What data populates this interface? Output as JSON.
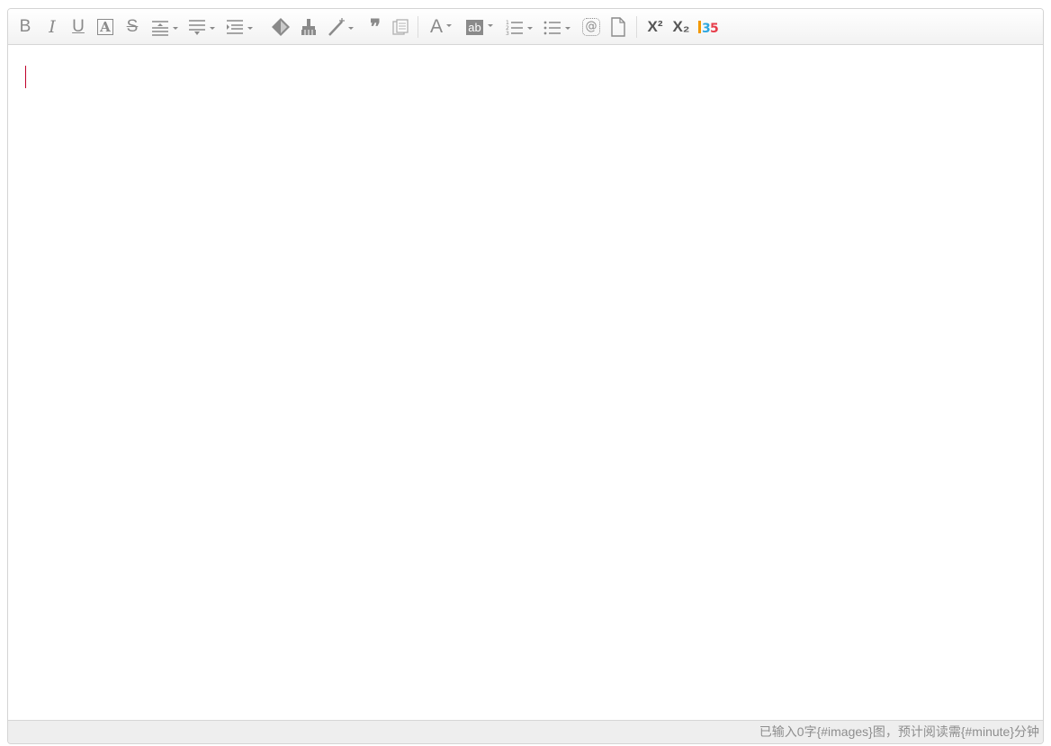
{
  "toolbar": {
    "buttons": [
      {
        "id": "bold",
        "label": "B"
      },
      {
        "id": "italic",
        "label": "I"
      },
      {
        "id": "underline",
        "label": "U"
      },
      {
        "id": "fontborder",
        "label": "A"
      },
      {
        "id": "strikethrough",
        "label": "S"
      },
      {
        "id": "rowspacingtop",
        "label": ""
      },
      {
        "id": "rowspacingbottom",
        "label": ""
      },
      {
        "id": "lineheight",
        "label": ""
      },
      {
        "id": "removeformat",
        "label": ""
      },
      {
        "id": "formatmatch",
        "label": ""
      },
      {
        "id": "autotypeset",
        "label": ""
      },
      {
        "id": "blockquote",
        "label": "❞"
      },
      {
        "id": "pasteplain",
        "label": ""
      },
      {
        "id": "forecolor",
        "label": "A"
      },
      {
        "id": "backcolor",
        "label": "ab"
      },
      {
        "id": "insertorderedlist",
        "label": ""
      },
      {
        "id": "insertunorderedlist",
        "label": ""
      },
      {
        "id": "insertcode",
        "label": "@"
      },
      {
        "id": "newpage",
        "label": ""
      },
      {
        "id": "superscript",
        "label": "X²"
      },
      {
        "id": "subscript",
        "label": "X₂"
      },
      {
        "id": "135editor",
        "label": "135"
      }
    ]
  },
  "status": {
    "text": "已输入0字{#images}图，预计阅读需{#minute}分钟"
  }
}
